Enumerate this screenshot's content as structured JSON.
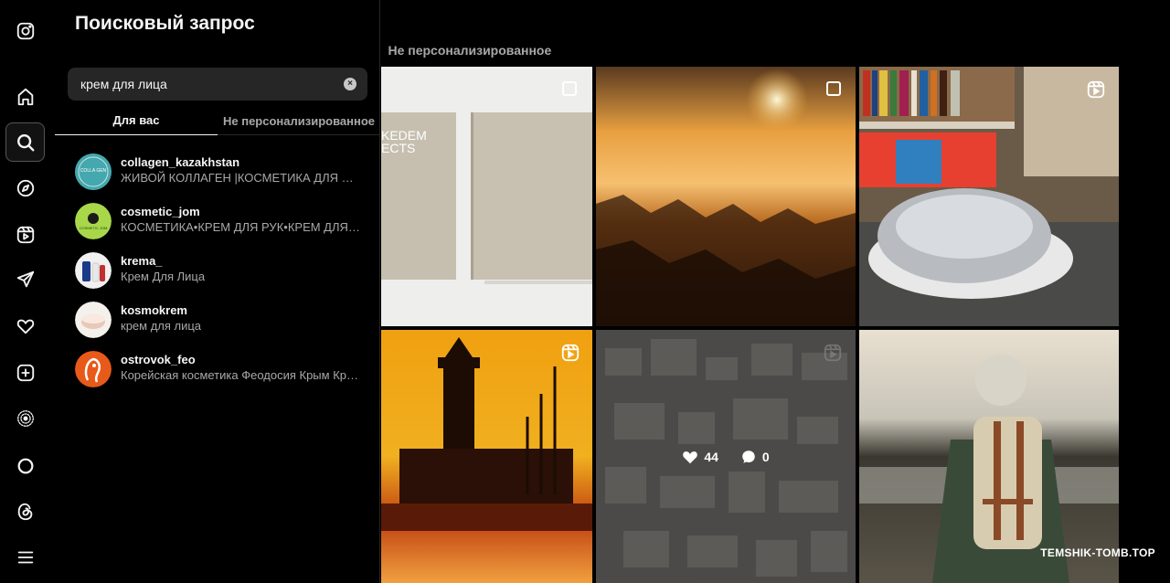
{
  "panel": {
    "title": "Поисковый запрос",
    "search_value": "крем для лица",
    "tabs": [
      "Для вас",
      "Не персонализированное"
    ]
  },
  "results": [
    {
      "username": "collagen_kazakhstan",
      "description": "ЖИВОЙ КОЛЛАГЕН |КОСМЕТИКА ДЛЯ ЛИЦ...",
      "avatar_text": "COLLA GEN"
    },
    {
      "username": "cosmetic_jom",
      "description": "КОСМЕТИКА•КРЕМ ДЛЯ РУК•КРЕМ ДЛЯ ЛИ...",
      "avatar_text": "COSMETIC JOM"
    },
    {
      "username": "krema_",
      "description": "Крем Для Лица"
    },
    {
      "username": "kosmokrem",
      "description": "крем для лица"
    },
    {
      "username": "ostrovok_feo",
      "description": "Корейская косметика Феодосия Крым Кре..."
    }
  ],
  "background": {
    "tab_label": "Не персонализированное",
    "book_text": "KEDEM ECTS",
    "stats": {
      "likes": "44",
      "comments": "0"
    }
  },
  "watermark": "TEMSHIK-TOMB.TOP",
  "icons": {
    "rail": [
      "instagram-icon",
      "home-icon",
      "search-icon",
      "explore-icon",
      "reels-icon",
      "messages-icon",
      "notifications-icon",
      "create-icon",
      "meta-ai-icon",
      "circle-icon",
      "threads-icon",
      "menu-icon"
    ]
  },
  "colors": {
    "background": "#000000",
    "panel": "#000000",
    "search_bg": "#262626",
    "secondary_text": "#a8a8a8"
  }
}
